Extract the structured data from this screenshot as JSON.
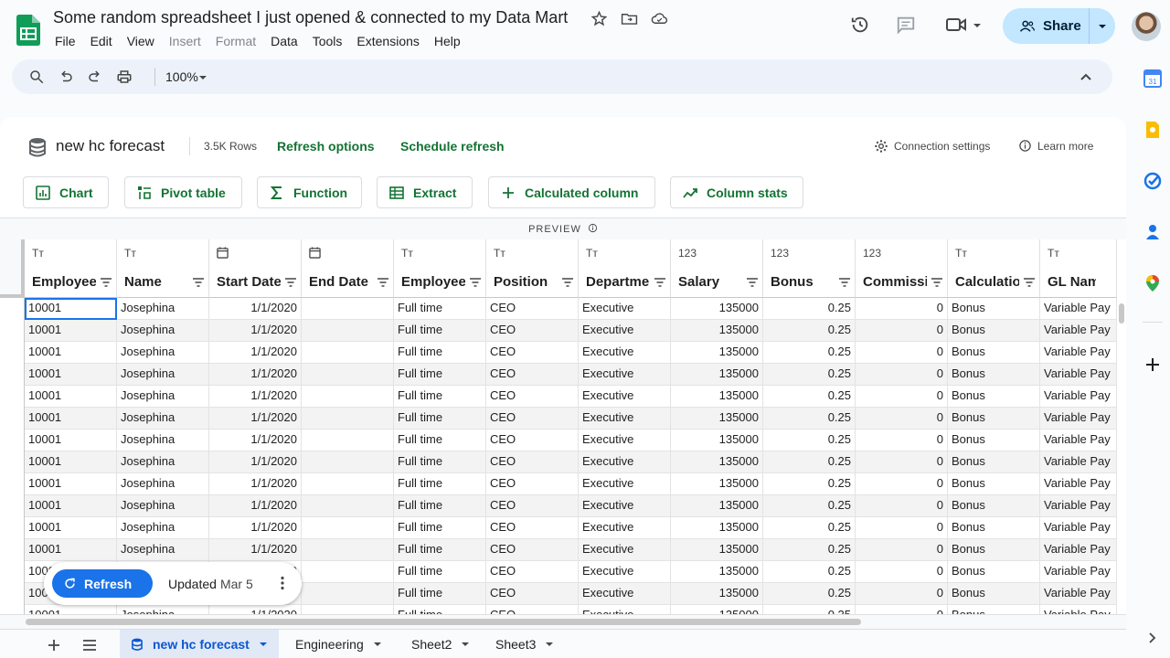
{
  "doc": {
    "title": "Some random spreadsheet I just opened & connected to my Data Mart"
  },
  "menu": [
    {
      "label": "File",
      "enabled": true
    },
    {
      "label": "Edit",
      "enabled": true
    },
    {
      "label": "View",
      "enabled": true
    },
    {
      "label": "Insert",
      "enabled": false
    },
    {
      "label": "Format",
      "enabled": false
    },
    {
      "label": "Data",
      "enabled": true
    },
    {
      "label": "Tools",
      "enabled": true
    },
    {
      "label": "Extensions",
      "enabled": true
    },
    {
      "label": "Help",
      "enabled": true
    }
  ],
  "share": {
    "label": "Share"
  },
  "toolbar": {
    "zoom": "100%"
  },
  "connection": {
    "name": "new hc forecast",
    "rows": "3.5K Rows",
    "refresh_options": "Refresh options",
    "schedule_refresh": "Schedule refresh",
    "settings": "Connection settings",
    "learn_more": "Learn more"
  },
  "actions": {
    "chart": "Chart",
    "pivot": "Pivot table",
    "function": "Function",
    "extract": "Extract",
    "calc_column": "Calculated column",
    "column_stats": "Column stats"
  },
  "preview_label": "PREVIEW",
  "columns": [
    {
      "type": "Tт",
      "name": "Employee"
    },
    {
      "type": "Tт",
      "name": "Name"
    },
    {
      "type": "date",
      "name": "Start Date"
    },
    {
      "type": "date",
      "name": "End Date"
    },
    {
      "type": "Tт",
      "name": "Employee"
    },
    {
      "type": "Tт",
      "name": "Position"
    },
    {
      "type": "Tт",
      "name": "Department"
    },
    {
      "type": "123",
      "name": "Salary"
    },
    {
      "type": "123",
      "name": "Bonus"
    },
    {
      "type": "123",
      "name": "Commission"
    },
    {
      "type": "Tт",
      "name": "Calculation"
    },
    {
      "type": "Tт",
      "name": "GL Name"
    }
  ],
  "row_values": [
    "10001",
    "Josephina",
    "1/1/2020",
    "",
    "Full time",
    "CEO",
    "Executive",
    "135000",
    "0.25",
    "0",
    "Bonus",
    "Variable Pay"
  ],
  "row_count_visible": 15,
  "refresh_bar": {
    "button": "Refresh",
    "updated": "Updated",
    "date": "Mar 5"
  },
  "sheets": [
    {
      "name": "new hc forecast",
      "active": true
    },
    {
      "name": "Engineering",
      "active": false
    },
    {
      "name": "Sheet2",
      "active": false
    },
    {
      "name": "Sheet3",
      "active": false
    }
  ],
  "colors": {
    "accent_green": "#137333",
    "accent_blue": "#1a73e8",
    "share_bg": "#c2e7ff"
  }
}
